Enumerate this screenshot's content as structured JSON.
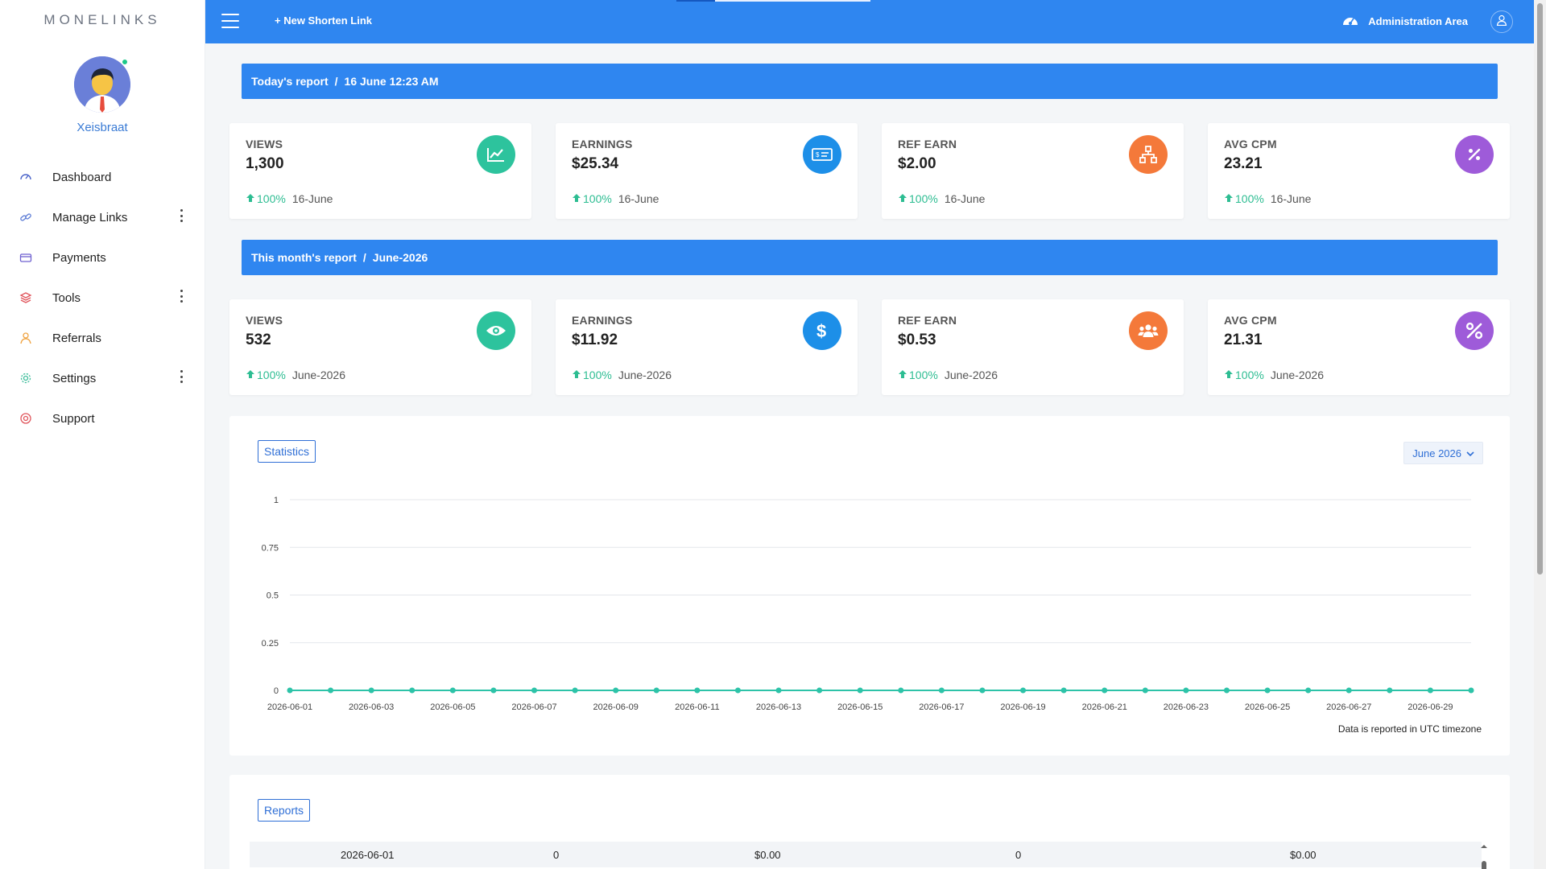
{
  "sidebar": {
    "logo": "MONELINKS",
    "username": "Xeisbraat",
    "items": [
      {
        "label": "Dashboard",
        "icon": "dashboard-gauge-icon",
        "color": "#4a63c9",
        "submenu": false
      },
      {
        "label": "Manage Links",
        "icon": "link-icon",
        "color": "#5b7bd5",
        "submenu": true
      },
      {
        "label": "Payments",
        "icon": "wallet-icon",
        "color": "#6f61d0",
        "submenu": false
      },
      {
        "label": "Tools",
        "icon": "layers-icon",
        "color": "#e0545b",
        "submenu": true
      },
      {
        "label": "Referrals",
        "icon": "referral-user-icon",
        "color": "#f0a340",
        "submenu": false
      },
      {
        "label": "Settings",
        "icon": "gear-icon",
        "color": "#3dbd9a",
        "submenu": true
      },
      {
        "label": "Support",
        "icon": "lifebuoy-icon",
        "color": "#e0545b",
        "submenu": false
      }
    ]
  },
  "topbar": {
    "new_link": "+ New Shorten Link",
    "admin_area": "Administration Area"
  },
  "today": {
    "banner_title": "Today's report",
    "banner_date": "16 June 12:23 AM",
    "cards": [
      {
        "label": "VIEWS",
        "value": "1,300",
        "pct": "100%",
        "period": "16-June",
        "icon": "chart-line-icon",
        "color": "#2dc39d"
      },
      {
        "label": "EARNINGS",
        "value": "$25.34",
        "pct": "100%",
        "period": "16-June",
        "icon": "money-bill-icon",
        "color": "#1d8fe8"
      },
      {
        "label": "REF EARN",
        "value": "$2.00",
        "pct": "100%",
        "period": "16-June",
        "icon": "sitemap-icon",
        "color": "#f4793a"
      },
      {
        "label": "AVG CPM",
        "value": "23.21",
        "pct": "100%",
        "period": "16-June",
        "icon": "percent-icon",
        "color": "#9e5bd9"
      }
    ]
  },
  "month": {
    "banner_title": "This month's report",
    "banner_date": "June-2026",
    "cards": [
      {
        "label": "VIEWS",
        "value": "532",
        "pct": "100%",
        "period": "June-2026",
        "icon": "eye-icon",
        "color": "#2dc39d"
      },
      {
        "label": "EARNINGS",
        "value": "$11.92",
        "pct": "100%",
        "period": "June-2026",
        "icon": "dollar-icon",
        "color": "#1d8fe8"
      },
      {
        "label": "REF EARN",
        "value": "$0.53",
        "pct": "100%",
        "period": "June-2026",
        "icon": "users-icon",
        "color": "#f4793a"
      },
      {
        "label": "AVG CPM",
        "value": "21.31",
        "pct": "100%",
        "period": "June-2026",
        "icon": "percent-icon",
        "color": "#9e5bd9"
      }
    ]
  },
  "statistics": {
    "tag": "Statistics",
    "month_select": "June 2026",
    "note": "Data is reported in UTC timezone"
  },
  "chart_data": {
    "type": "line",
    "x": [
      "2026-06-01",
      "2026-06-02",
      "2026-06-03",
      "2026-06-04",
      "2026-06-05",
      "2026-06-06",
      "2026-06-07",
      "2026-06-08",
      "2026-06-09",
      "2026-06-10",
      "2026-06-11",
      "2026-06-12",
      "2026-06-13",
      "2026-06-14",
      "2026-06-15",
      "2026-06-16",
      "2026-06-17",
      "2026-06-18",
      "2026-06-19",
      "2026-06-20",
      "2026-06-21",
      "2026-06-22",
      "2026-06-23",
      "2026-06-24",
      "2026-06-25",
      "2026-06-26",
      "2026-06-27",
      "2026-06-28",
      "2026-06-29",
      "2026-06-30"
    ],
    "x_tick_labels": [
      "2026-06-01",
      "2026-06-03",
      "2026-06-05",
      "2026-06-07",
      "2026-06-09",
      "2026-06-11",
      "2026-06-13",
      "2026-06-15",
      "2026-06-17",
      "2026-06-19",
      "2026-06-21",
      "2026-06-23",
      "2026-06-25",
      "2026-06-27",
      "2026-06-29"
    ],
    "series": [
      {
        "values": [
          0,
          0,
          0,
          0,
          0,
          0,
          0,
          0,
          0,
          0,
          0,
          0,
          0,
          0,
          0,
          0,
          0,
          0,
          0,
          0,
          0,
          0,
          0,
          0,
          0,
          0,
          0,
          0,
          0,
          0
        ],
        "color": "#2dc3a8"
      }
    ],
    "y_ticks": [
      "1",
      "0.75",
      "0.5",
      "0.25",
      "0"
    ],
    "ylim": [
      0,
      1
    ],
    "grid": true,
    "title": "",
    "xlabel": "",
    "ylabel": ""
  },
  "reports": {
    "tag": "Reports",
    "first_row": [
      "2026-06-01",
      "0",
      "$0.00",
      "0",
      "$0.00"
    ]
  }
}
